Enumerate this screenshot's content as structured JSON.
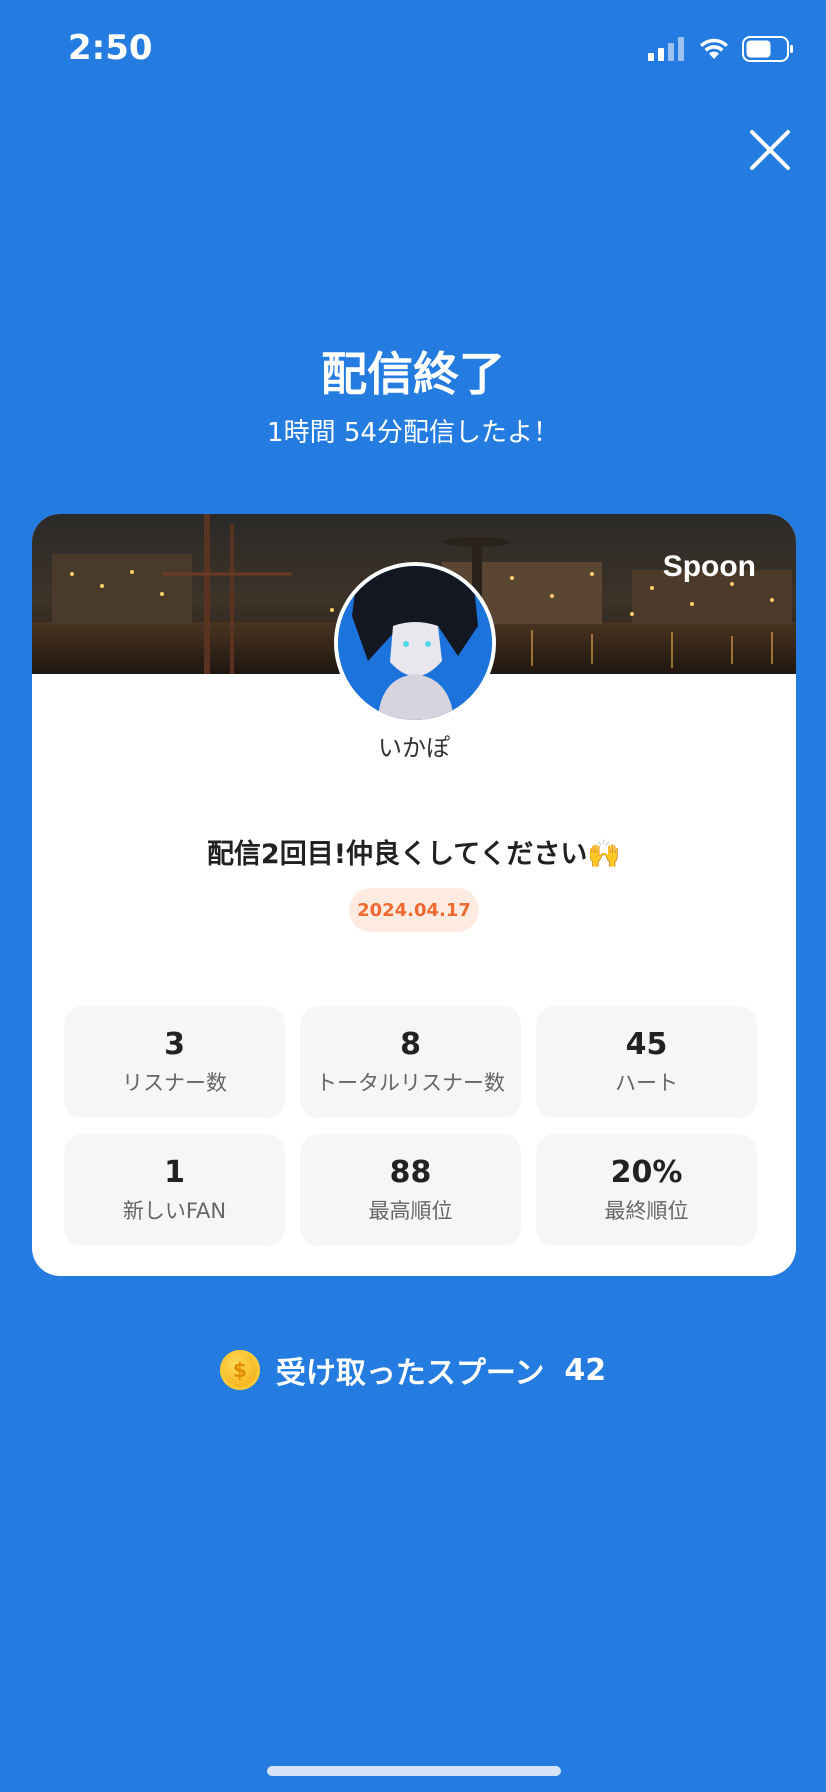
{
  "status_bar": {
    "time": "2:50",
    "icons": [
      "signal-icon",
      "wifi-icon",
      "battery-icon"
    ]
  },
  "header": {
    "close_icon": "close-icon",
    "title": "配信終了",
    "subtitle": "1時間 54分配信したよ！"
  },
  "card": {
    "brand": "Spoon",
    "nickname": "いかぽ",
    "cast_title": "配信2回目!仲良くしてください🙌",
    "date": "2024.04.17",
    "stats": [
      {
        "value": "3",
        "label": "リスナー数"
      },
      {
        "value": "8",
        "label": "トータルリスナー数"
      },
      {
        "value": "45",
        "label": "ハート"
      },
      {
        "value": "1",
        "label": "新しいFAN"
      },
      {
        "value": "88",
        "label": "最高順位"
      },
      {
        "value": "20%",
        "label": "最終順位"
      }
    ]
  },
  "spoons": {
    "icon": "coin-icon",
    "label": "受け取ったスプーン",
    "count": "42"
  },
  "colors": {
    "background": "#247ce0",
    "accent_orange": "#ee6a2f",
    "date_badge_bg": "#fdebe2"
  }
}
